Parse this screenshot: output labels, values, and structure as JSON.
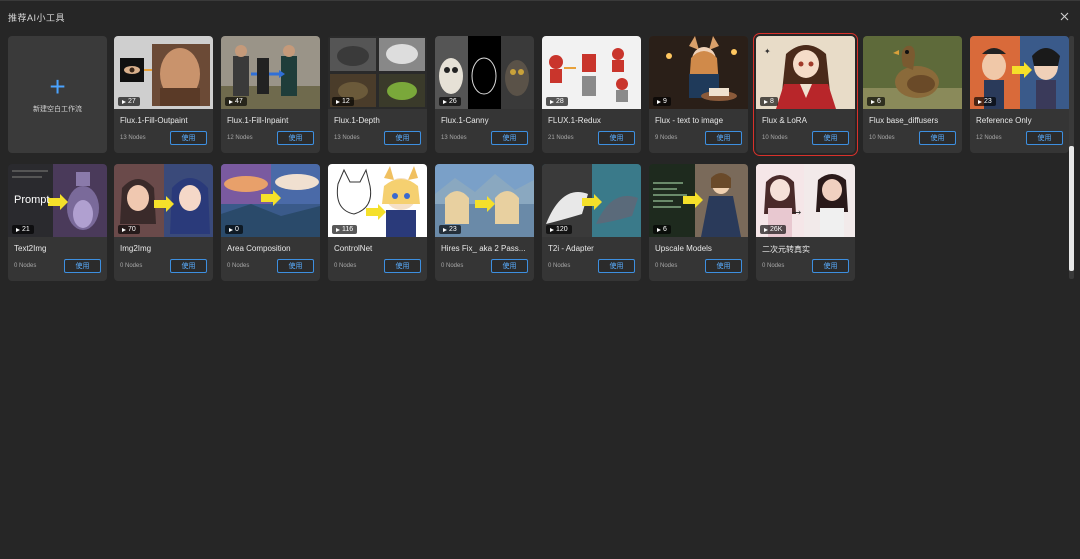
{
  "dialog": {
    "title": "推荐AI小工具",
    "close_icon": "close-icon"
  },
  "new_workflow": {
    "label": "新建空白工作流",
    "icon": "plus-icon"
  },
  "colors": {
    "accent": "#3d8fe0",
    "selected_outline": "#d9312b",
    "background": "#262626",
    "card": "#353535"
  },
  "cards": [
    {
      "name": "Flux.1-Fill-Outpaint",
      "runs": "27",
      "nodes": "13 Nodes",
      "button": "使用",
      "selected": false
    },
    {
      "name": "Flux.1-Fill-Inpaint",
      "runs": "47",
      "nodes": "12 Nodes",
      "button": "使用",
      "selected": false
    },
    {
      "name": "Flux.1-Depth",
      "runs": "12",
      "nodes": "13 Nodes",
      "button": "使用",
      "selected": false
    },
    {
      "name": "Flux.1-Canny",
      "runs": "26",
      "nodes": "13 Nodes",
      "button": "使用",
      "selected": false
    },
    {
      "name": "FLUX.1-Redux",
      "runs": "28",
      "nodes": "21 Nodes",
      "button": "使用",
      "selected": false
    },
    {
      "name": "Flux - text to image",
      "runs": "9",
      "nodes": "9 Nodes",
      "button": "使用",
      "selected": false
    },
    {
      "name": "Flux & LoRA",
      "runs": "8",
      "nodes": "10 Nodes",
      "button": "使用",
      "selected": true
    },
    {
      "name": "Flux base_diffusers",
      "runs": "6",
      "nodes": "10 Nodes",
      "button": "使用",
      "selected": false
    },
    {
      "name": "Reference Only",
      "runs": "23",
      "nodes": "12 Nodes",
      "button": "使用",
      "selected": false
    },
    {
      "name": "Text2Img",
      "runs": "21",
      "nodes": "0 Nodes",
      "button": "使用",
      "selected": false,
      "thumb_text": "Prompt"
    },
    {
      "name": "Img2Img",
      "runs": "70",
      "nodes": "0 Nodes",
      "button": "使用",
      "selected": false
    },
    {
      "name": "Area Composition",
      "runs": "0",
      "nodes": "0 Nodes",
      "button": "使用",
      "selected": false
    },
    {
      "name": "ControlNet",
      "runs": "116",
      "nodes": "0 Nodes",
      "button": "使用",
      "selected": false
    },
    {
      "name": "Hires Fix_ aka 2 Pass...",
      "runs": "23",
      "nodes": "0 Nodes",
      "button": "使用",
      "selected": false
    },
    {
      "name": "T2i - Adapter",
      "runs": "120",
      "nodes": "0 Nodes",
      "button": "使用",
      "selected": false
    },
    {
      "name": "Upscale Models",
      "runs": "6",
      "nodes": "0 Nodes",
      "button": "使用",
      "selected": false
    },
    {
      "name": "二次元转真实",
      "runs": "26K",
      "nodes": "0 Nodes",
      "button": "使用",
      "selected": false
    }
  ]
}
